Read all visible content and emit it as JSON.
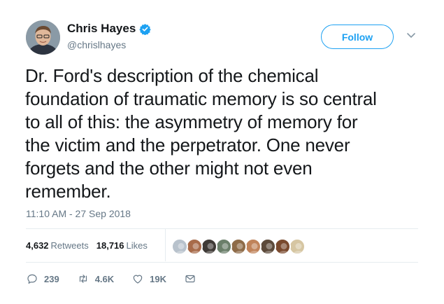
{
  "author": {
    "name": "Chris Hayes",
    "handle": "@chrislhayes",
    "verified": true
  },
  "follow_button": {
    "label": "Follow"
  },
  "tweet": {
    "lines": [
      "Dr. Ford's description of the chemical",
      "foundation of traumatic memory is so central",
      "to all of this: the asymmetry of memory for",
      "the victim and the perpetrator. One never",
      "forgets and the other might not even",
      "remember."
    ],
    "timestamp": "11:10 AM - 27 Sep 2018"
  },
  "stats": {
    "retweets_count": "4,632",
    "retweets_label": "Retweets",
    "likes_count": "18,716",
    "likes_label": "Likes"
  },
  "liker_avatar_colors": [
    "#b8c2cc",
    "#a86b4a",
    "#3f3a36",
    "#6b7f6a",
    "#8e6b48",
    "#c0835a",
    "#5c4a3a",
    "#7a4a2e",
    "#d6c6a2"
  ],
  "actions": {
    "replies": "239",
    "retweets": "4.6K",
    "likes": "19K"
  },
  "colors": {
    "accent": "#1da1f2",
    "muted": "#657786",
    "text": "#14171a"
  }
}
